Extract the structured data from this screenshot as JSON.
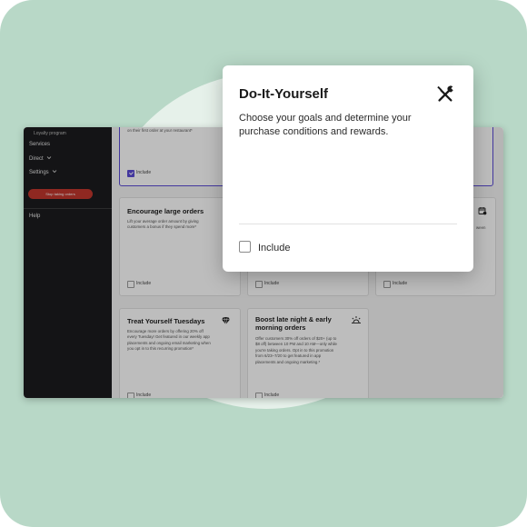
{
  "sidebar": {
    "items": [
      "Loyalty program",
      "Services",
      "Direct",
      "Settings"
    ],
    "stop_button": "Stop taking orders",
    "help": "Help"
  },
  "cards": {
    "top_left": {
      "body": "on their first order at your restaurant*",
      "include": "Include",
      "checked": true
    },
    "large_orders": {
      "title": "Encourage large orders",
      "body_lines": [
        "Lift your average order amount by giving",
        "customers a bonus if they spend more*"
      ],
      "include": "Include"
    },
    "middle_top": {
      "include": "Include"
    },
    "right_top": {
      "body_lines": [
        "ween"
      ],
      "include": "Include",
      "icon": "calendar-icon"
    },
    "tuesdays": {
      "title": "Treat Yourself Tuesdays",
      "body_lines": [
        "Encourage more orders by offering 20% off",
        "every Tuesday! Get featured in our weekly app",
        "placements and ongoing email marketing when",
        "you opt in to this recurring promotion*"
      ],
      "include": "Include",
      "icon": "diamond-icon"
    },
    "late_night": {
      "title_lines": [
        "Boost late night & early",
        "morning orders"
      ],
      "body_lines": [
        "Offer customers 30% off orders of $20+ (up to",
        "$8 off) between 10 PM and 10 AM—only while",
        "you're taking orders. Opt in to this promotion",
        "from 6/23–7/20 to get featured in app",
        "placements and ongoing marketing.*"
      ],
      "include": "Include",
      "icon": "sunrise-icon"
    }
  },
  "modal": {
    "title": "Do-It-Yourself",
    "description": "Choose your goals and determine your purchase conditions and rewards.",
    "include": "Include",
    "icon": "tools-icon"
  },
  "colors": {
    "background": "#b8d8c7",
    "accent": "#5b4bd6",
    "stop_button": "#c2362d",
    "sidebar": "#1c1c1e"
  }
}
